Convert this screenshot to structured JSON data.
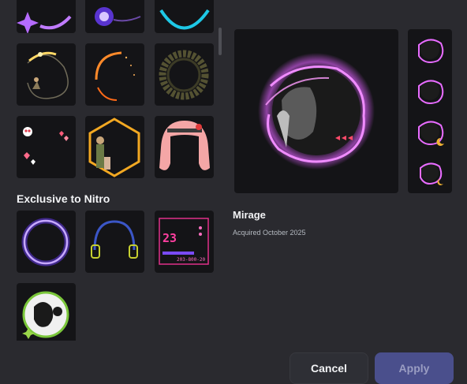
{
  "section": {
    "exclusive_label": "Exclusive to Nitro"
  },
  "selected": {
    "name": "Mirage",
    "acquired": "Acquired October 2025"
  },
  "tile_text": {
    "digital_number": "23",
    "digital_small": "203-800-20"
  },
  "buttons": {
    "cancel": "Cancel",
    "apply": "Apply"
  },
  "colors": {
    "background": "#2a2a2f",
    "tile": "#141417",
    "apply": "#4a4f8c",
    "cancel": "#2e2f35"
  },
  "decorations": [
    {
      "icon": "purple-sparkle-icon"
    },
    {
      "icon": "violet-orb-icon"
    },
    {
      "icon": "cyan-ring-icon"
    },
    {
      "icon": "golden-string-lights-icon"
    },
    {
      "icon": "orange-arc-icon"
    },
    {
      "icon": "olive-gear-ring-icon"
    },
    {
      "icon": "hearts-skull-icon"
    },
    {
      "icon": "hexagon-figures-icon"
    },
    {
      "icon": "pink-hair-icon"
    },
    {
      "icon": "purple-glow-ring-icon"
    },
    {
      "icon": "headphones-icon"
    },
    {
      "icon": "digital-frame-icon"
    },
    {
      "icon": "green-cow-ring-icon"
    }
  ]
}
